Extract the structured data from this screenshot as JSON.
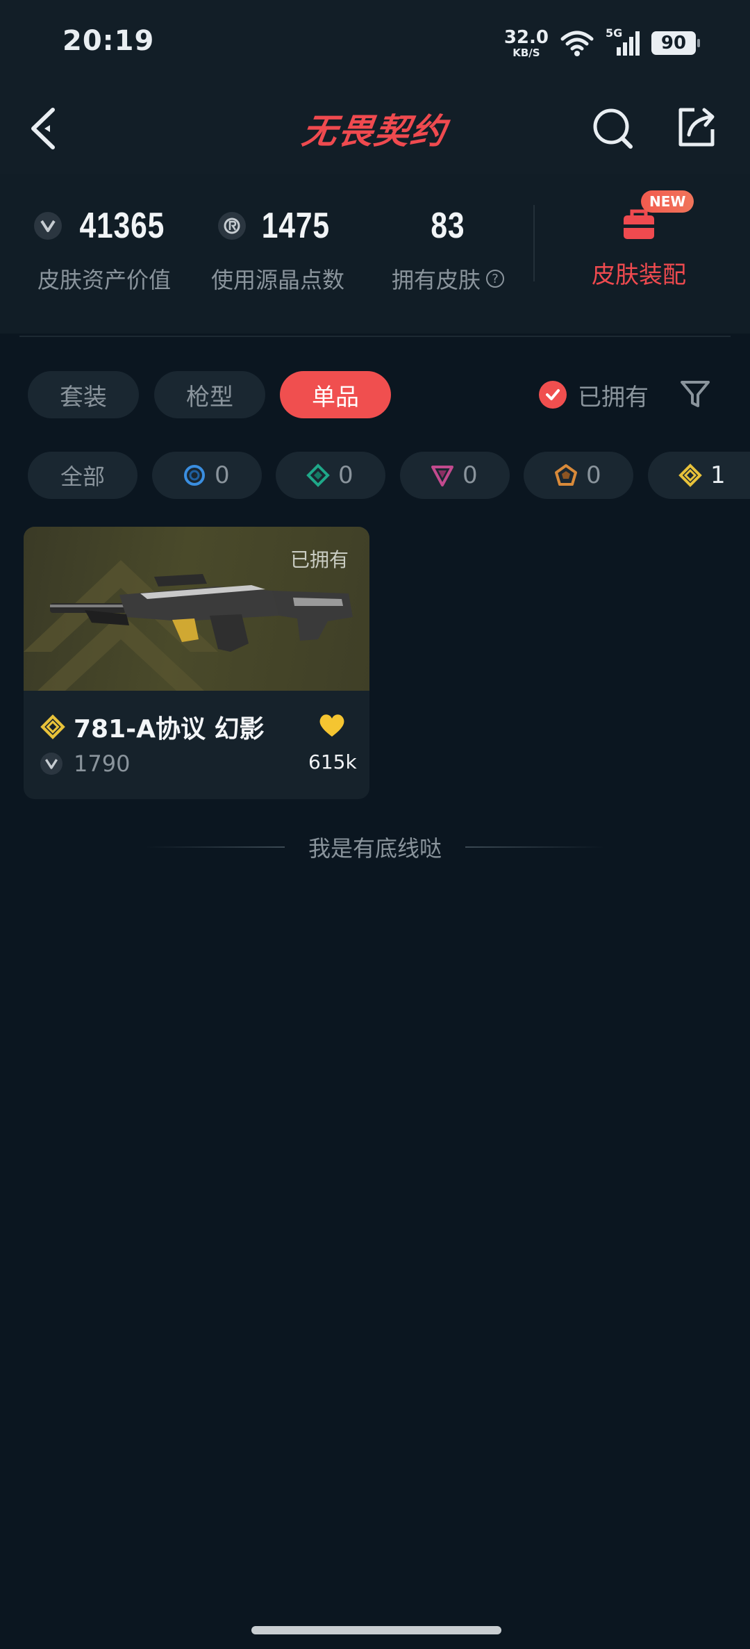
{
  "status_bar": {
    "time": "20:19",
    "net_speed_value": "32.0",
    "net_speed_unit": "KB/S",
    "network_type": "5G",
    "battery": "90"
  },
  "header": {
    "logo_text": "无畏契约",
    "back_icon": "back-arrow-icon",
    "search_icon": "search-icon",
    "share_icon": "share-icon"
  },
  "stats": {
    "asset_value": "41365",
    "asset_label": "皮肤资产价值",
    "radianite_used": "1475",
    "radianite_label": "使用源晶点数",
    "owned_skins": "83",
    "owned_label": "拥有皮肤",
    "loadout_badge": "NEW",
    "loadout_label": "皮肤装配"
  },
  "categories": [
    {
      "label": "套装",
      "active": false
    },
    {
      "label": "枪型",
      "active": false
    },
    {
      "label": "单品",
      "active": true
    }
  ],
  "owned_filter": {
    "label": "已拥有",
    "checked": true
  },
  "tiers": [
    {
      "label": "全部"
    },
    {
      "icon": "select-tier-icon",
      "count": "0",
      "color": "#3a8ee0"
    },
    {
      "icon": "deluxe-tier-icon",
      "count": "0",
      "color": "#1fa889"
    },
    {
      "icon": "premium-tier-icon",
      "count": "0",
      "color": "#c24a8e"
    },
    {
      "icon": "ultra-tier-icon",
      "count": "0",
      "color": "#d98a3a"
    },
    {
      "icon": "exclusive-tier-icon",
      "count": "1",
      "color": "#e8c23a"
    }
  ],
  "items": [
    {
      "owned_tag": "已拥有",
      "name": "781-A协议 幻影",
      "price": "1790",
      "likes": "615k",
      "tier_color": "#e8c23a"
    }
  ],
  "footer": {
    "text": "我是有底线哒"
  }
}
